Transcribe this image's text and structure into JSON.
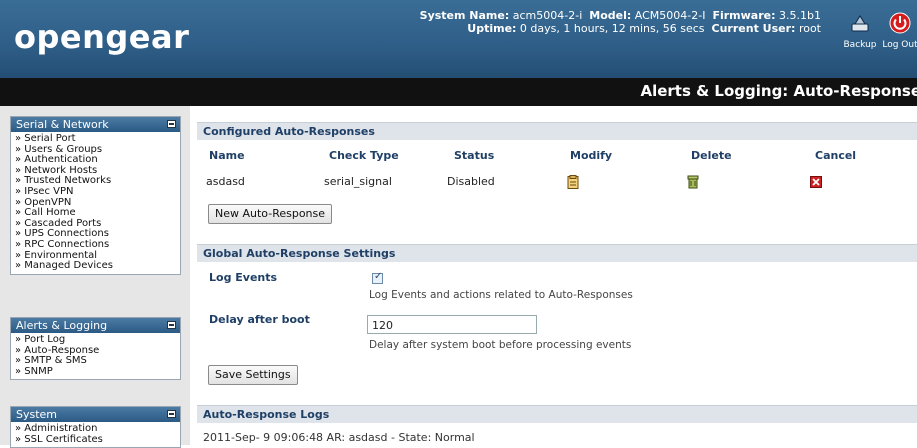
{
  "header": {
    "logo": "opengear",
    "system_name_label": "System Name:",
    "system_name": "acm5004-2-i",
    "model_label": "Model:",
    "model": "ACM5004-2-I",
    "firmware_label": "Firmware:",
    "firmware": "3.5.1b1",
    "uptime_label": "Uptime:",
    "uptime": "0 days, 1 hours, 12 mins, 56 secs",
    "current_user_label": "Current User:",
    "current_user": "root",
    "backup_label": "Backup",
    "logout_label": "Log Out"
  },
  "page_title": "Alerts & Logging: Auto-Response",
  "sidebar": {
    "serial_network": {
      "title": "Serial & Network",
      "items": [
        "Serial Port",
        "Users & Groups",
        "Authentication",
        "Network Hosts",
        "Trusted Networks",
        "IPsec VPN",
        "OpenVPN",
        "Call Home",
        "Cascaded Ports",
        "UPS Connections",
        "RPC Connections",
        "Environmental",
        "Managed Devices"
      ]
    },
    "alerts_logging": {
      "title": "Alerts & Logging",
      "items": [
        "Port Log",
        "Auto-Response",
        "SMTP & SMS",
        "SNMP"
      ]
    },
    "system": {
      "title": "System",
      "items": [
        "Administration",
        "SSL Certificates"
      ]
    }
  },
  "configured": {
    "title": "Configured Auto-Responses",
    "headers": {
      "name": "Name",
      "check_type": "Check Type",
      "status": "Status",
      "modify": "Modify",
      "delete": "Delete",
      "cancel": "Cancel"
    },
    "row": {
      "name": "asdasd",
      "check_type": "serial_signal",
      "status": "Disabled"
    },
    "new_button": "New Auto-Response"
  },
  "global": {
    "title": "Global Auto-Response Settings",
    "log_events_label": "Log Events",
    "log_events_hint": "Log Events and actions related to Auto-Responses",
    "delay_label": "Delay after boot",
    "delay_value": "120",
    "delay_hint": "Delay after system boot before processing events",
    "save_button": "Save Settings"
  },
  "logs": {
    "title": "Auto-Response Logs",
    "entry": "2011-Sep- 9 09:06:48 AR: asdasd - State: Normal"
  },
  "colors": {
    "header_blue": "#2f5f88",
    "section_head": "#dfe4ea",
    "section_text": "#1f3f66",
    "cancel_red": "#cc2222"
  }
}
